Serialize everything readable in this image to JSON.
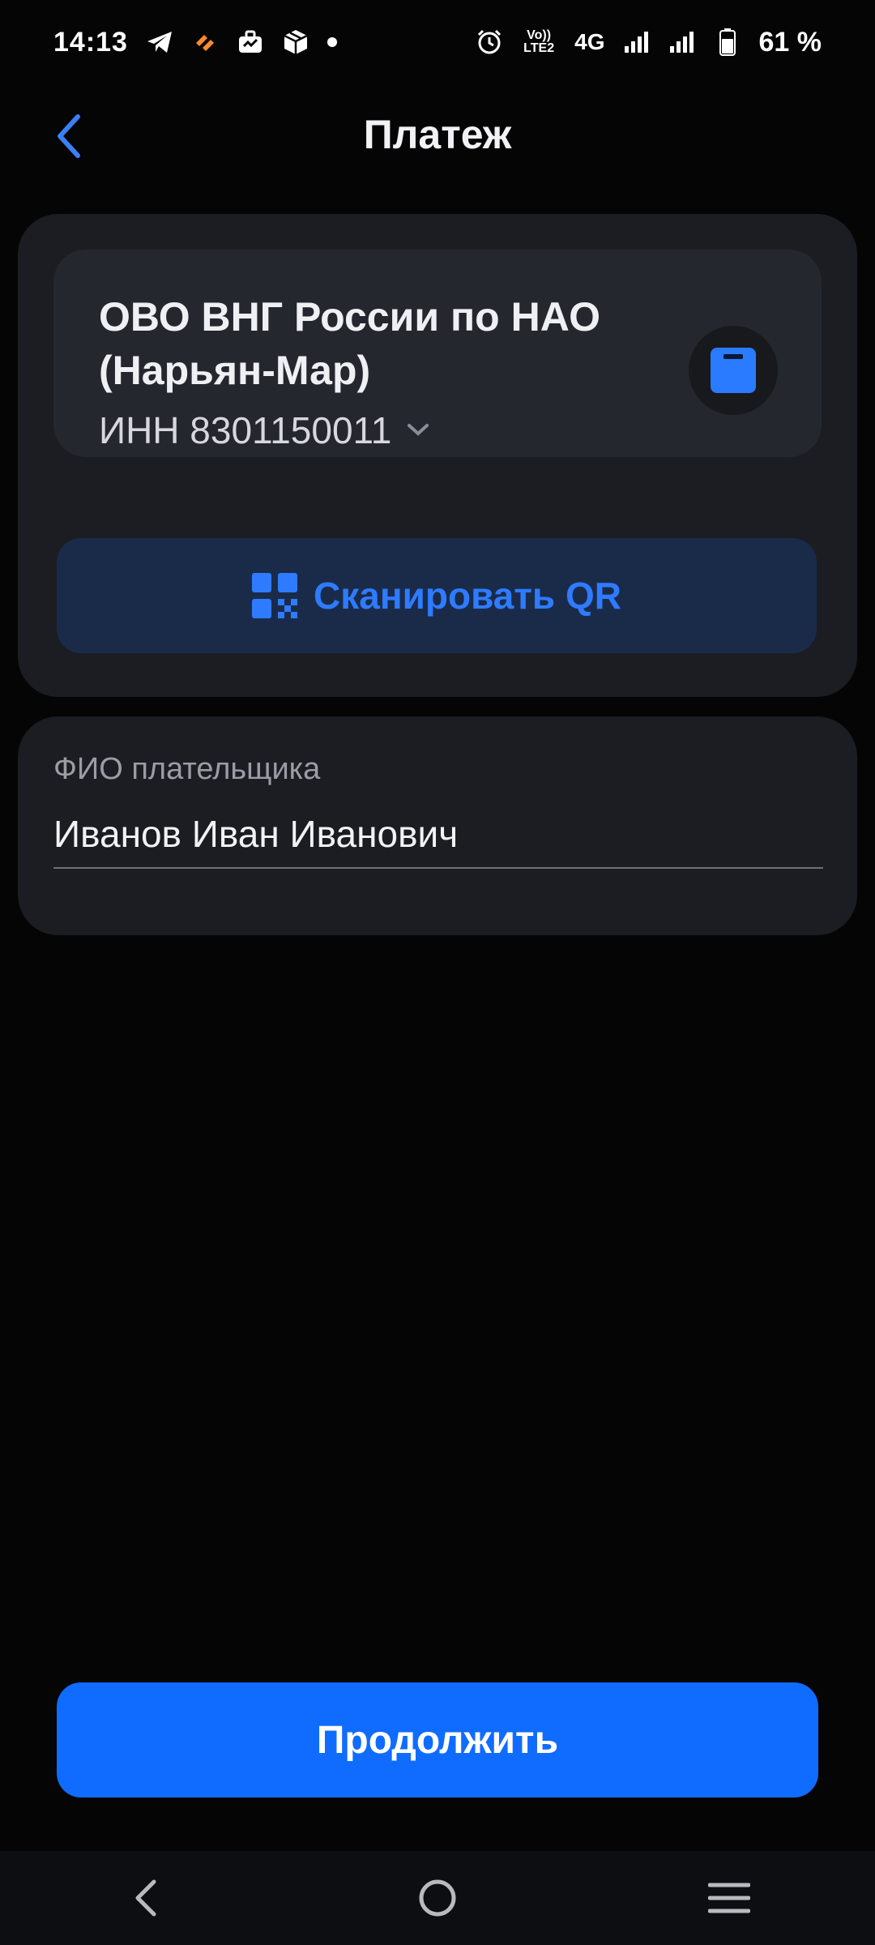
{
  "status_bar": {
    "time": "14:13",
    "network_small": "Vo)) LTE2",
    "network_type": "4G",
    "battery_percent": "61 %",
    "icons": [
      "telegram-icon",
      "app-icon",
      "briefcase-icon",
      "package-icon",
      "notification-dot",
      "alarm-icon",
      "signal-icon",
      "battery-icon"
    ]
  },
  "header": {
    "title": "Платеж"
  },
  "recipient": {
    "name": "ОВО ВНГ России по НАО (Нарьян-Мар)",
    "inn": "ИНН 8301150011",
    "icon": "document-icon"
  },
  "scan_button": {
    "label": "Сканировать QR",
    "icon": "qr-icon"
  },
  "payer": {
    "label": "ФИО плательщика",
    "value": "Иванов Иван Иванович"
  },
  "continue_button": {
    "label": "Продолжить"
  },
  "colors": {
    "accent": "#0f6cff",
    "accent_text": "#2e7bff",
    "card": "#1b1d22",
    "inner_card": "#25272e",
    "background": "#050506"
  }
}
